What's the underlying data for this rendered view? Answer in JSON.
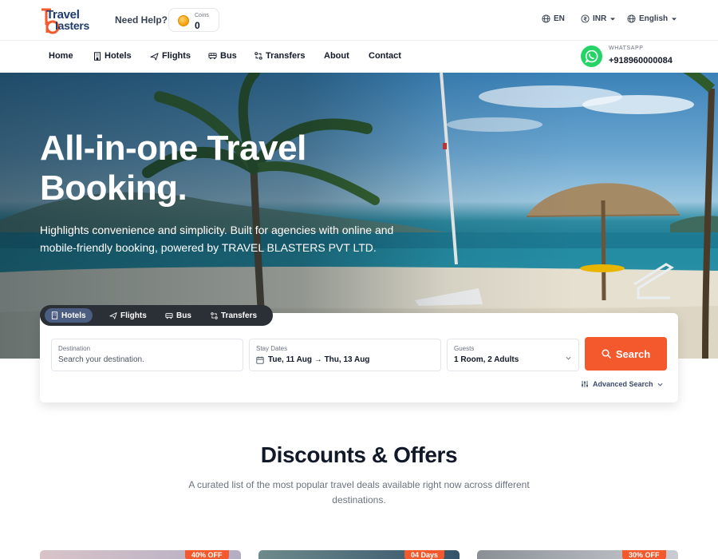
{
  "brand": {
    "name_line1": "Travel",
    "name_line2": "lasters",
    "accent": "#f4592d",
    "navy": "#1f3b6e"
  },
  "topbar": {
    "need_help": "Need Help?",
    "coins_label": "Coins",
    "coins_value": "0",
    "lang_short": "EN",
    "currency": "INR",
    "language": "English"
  },
  "nav": {
    "items": [
      {
        "label": "Home",
        "icon": ""
      },
      {
        "label": "Hotels",
        "icon": "building-icon"
      },
      {
        "label": "Flights",
        "icon": "plane-icon"
      },
      {
        "label": "Bus",
        "icon": "bus-icon"
      },
      {
        "label": "Transfers",
        "icon": "transfer-icon"
      },
      {
        "label": "About",
        "icon": ""
      },
      {
        "label": "Contact",
        "icon": ""
      }
    ],
    "whatsapp_label": "WHATSAPP",
    "whatsapp_number": "+918960000084"
  },
  "hero": {
    "title": "All-in-one Travel Booking.",
    "subtitle": "Highlights convenience and simplicity. Built for agencies with online and mobile-friendly booking, powered by TRAVEL BLASTERS PVT LTD."
  },
  "search": {
    "tabs": [
      {
        "label": "Hotels",
        "active": true
      },
      {
        "label": "Flights",
        "active": false
      },
      {
        "label": "Bus",
        "active": false
      },
      {
        "label": "Transfers",
        "active": false
      }
    ],
    "destination_label": "Destination",
    "destination_placeholder": "Search your destination.",
    "dates_label": "Stay Dates",
    "dates_value": "Tue, 11 Aug → Thu, 13 Aug",
    "guests_label": "Guests",
    "guests_value": "1 Room, 2 Adults",
    "button_label": "Search",
    "advanced_label": "Advanced Search"
  },
  "offers": {
    "title": "Discounts & Offers",
    "subtitle": "A curated list of the most popular travel deals available right now across different destinations.",
    "cards": [
      {
        "badge": "40% OFF"
      },
      {
        "badge": "04 Days"
      },
      {
        "badge": "30% OFF"
      }
    ]
  }
}
